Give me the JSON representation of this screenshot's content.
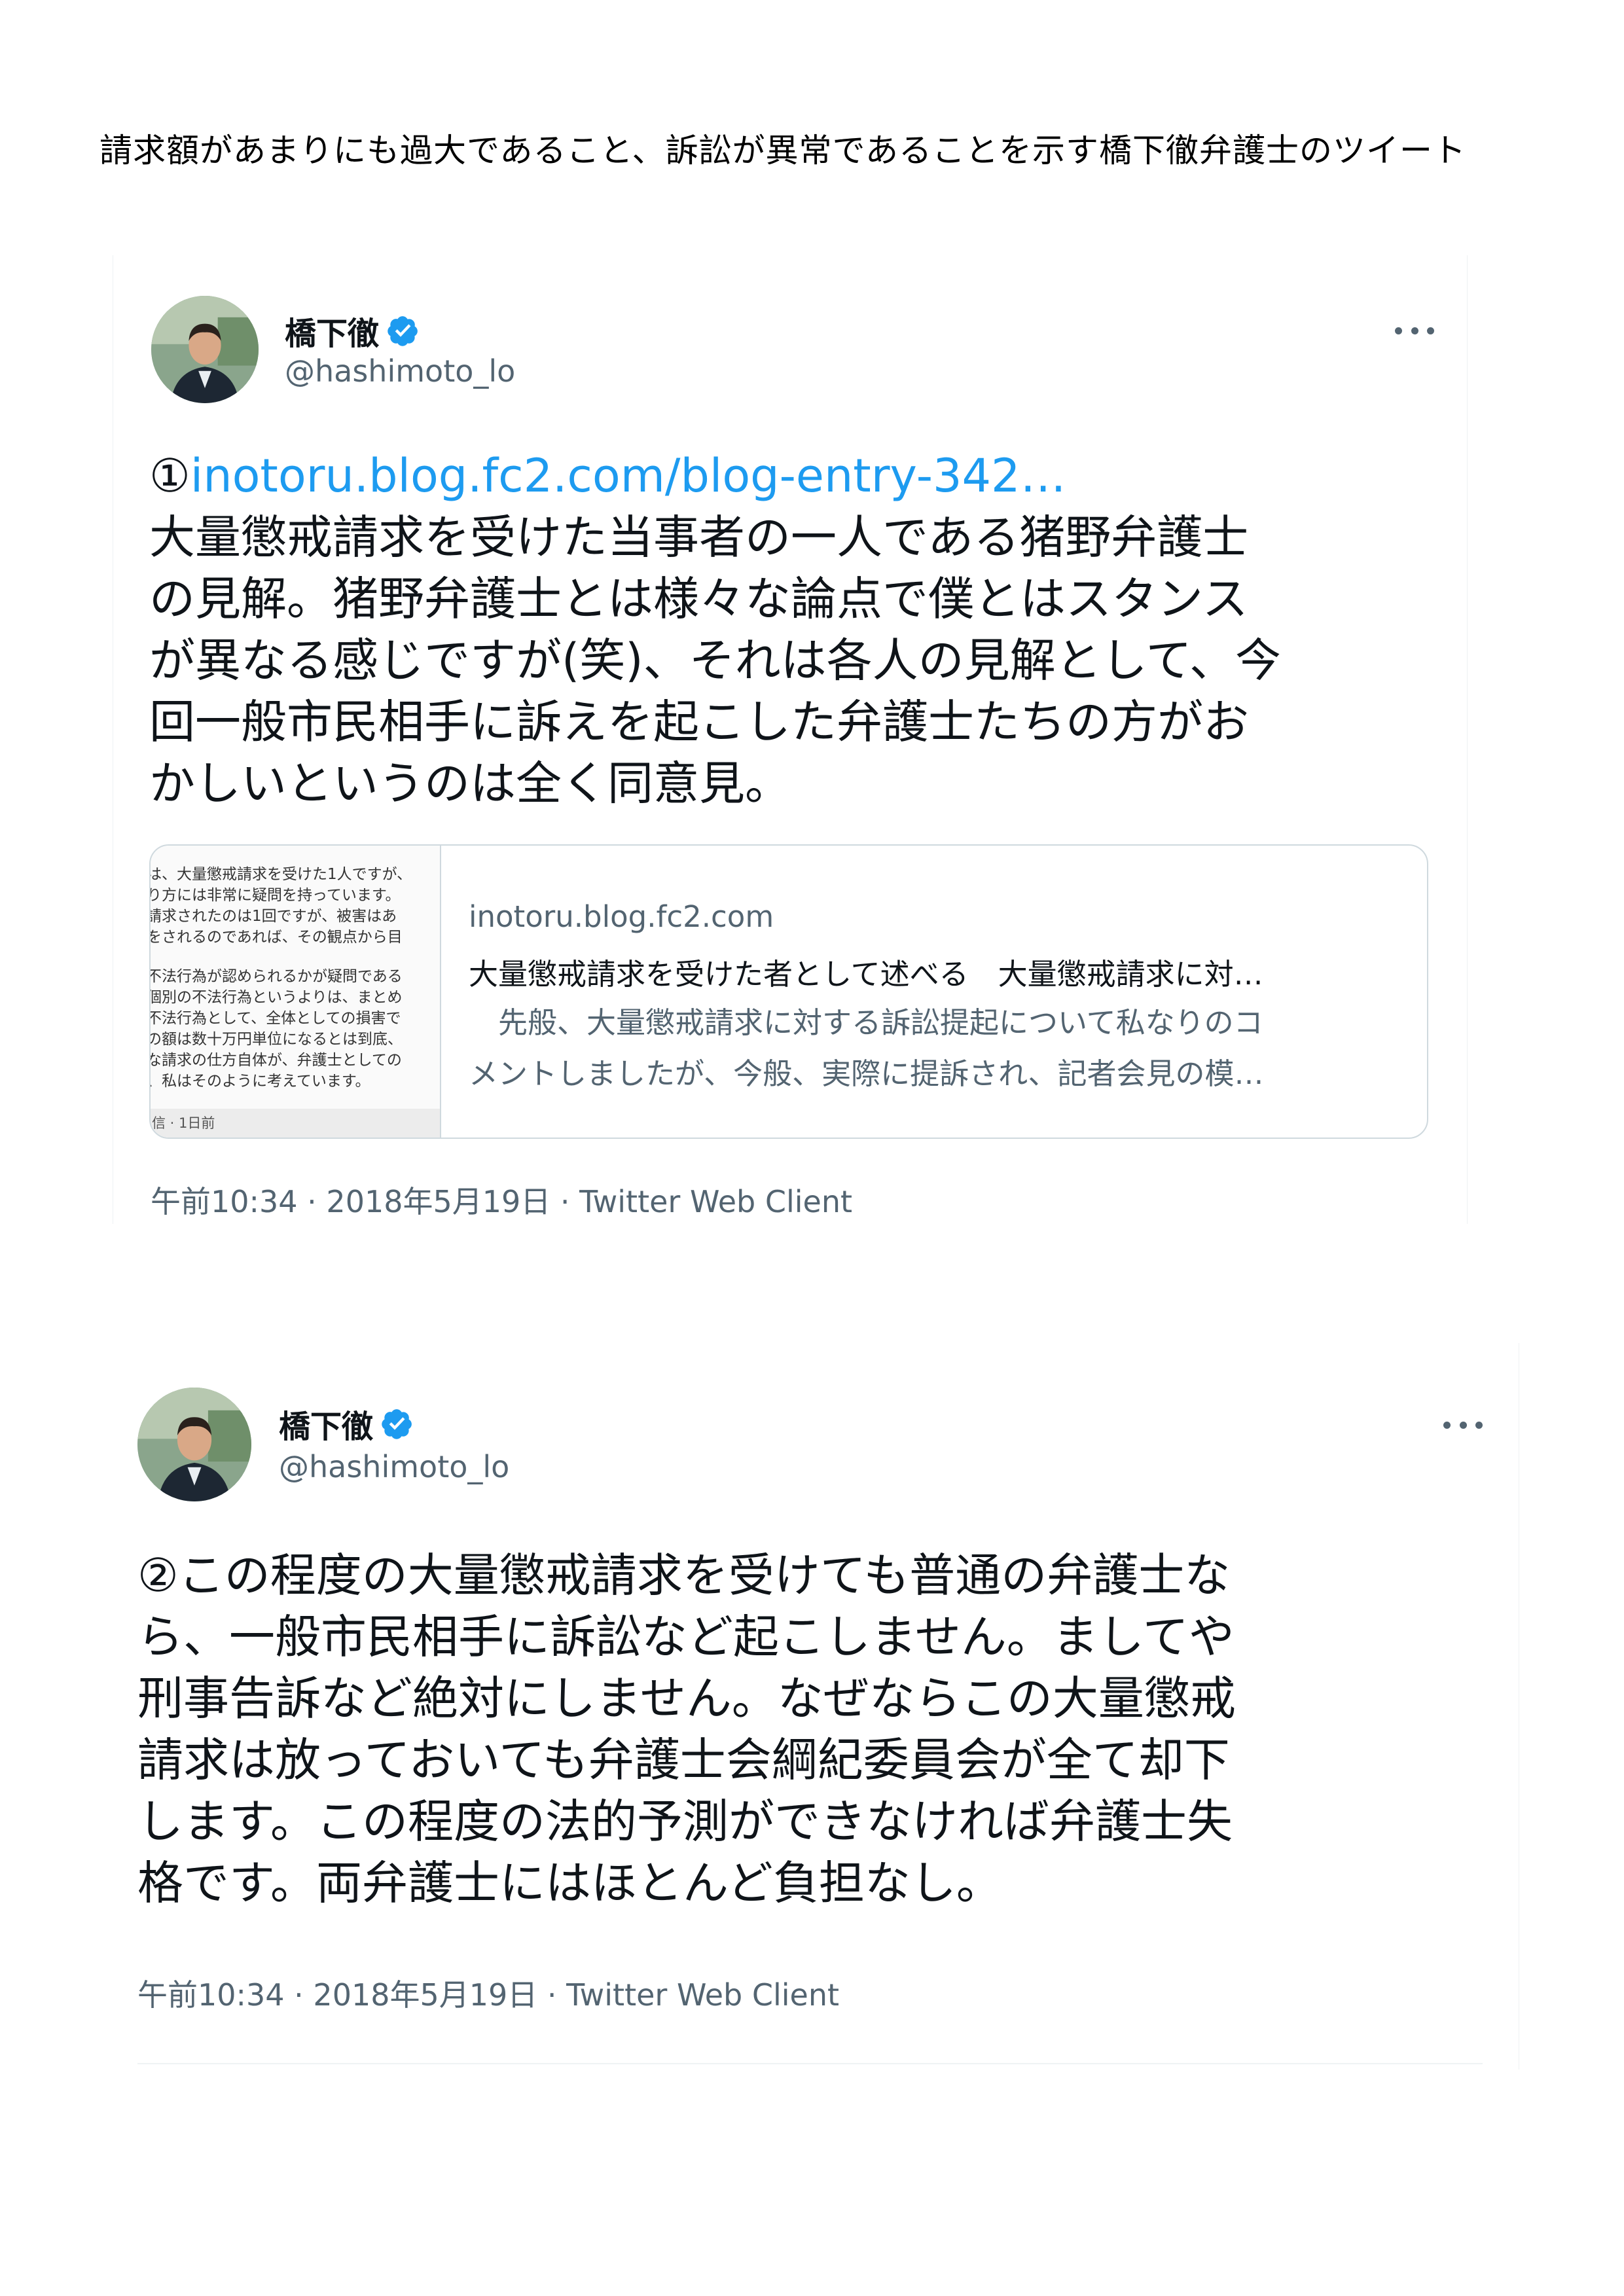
{
  "heading": "請求額があまりにも過大であること、訴訟が異常であることを示す橋下徹弁護士のツイート",
  "tweets": [
    {
      "name": "橋下徹",
      "handle": "@hashimoto_lo",
      "prefix": "①",
      "link": "inotoru.blog.fc2.com/blog-entry-342…",
      "lines": [
        "大量懲戒請求を受けた当事者の一人である猪野弁護士",
        "の見解。猪野弁護士とは様々な論点で僕とはスタンス",
        "が異なる感じですが(笑)、それは各人の見解として、今",
        "回一般市民相手に訴えを起こした弁護士たちの方がお",
        "かしいというのは全く同意見。"
      ],
      "card": {
        "thumb_lines": [
          "は、大量懲戒請求を受けた1人ですが、",
          "り方には非常に疑問を持っています。",
          "請求されたのは1回ですが、被害はあ",
          "をされるのであれば、その観点から目",
          "",
          "不法行為が認められるかが疑問である",
          "個別の不法行為というよりは、まとめ",
          "不法行為として、全体としての損害で",
          "の額は数十万円単位になるとは到底、",
          "な請求の仕方自体が、弁護士としての",
          "、私はそのように考えています。"
        ],
        "thumb_footer": "信 · 1日前",
        "domain": "inotoru.blog.fc2.com",
        "title": "大量懲戒請求を受けた者として述べる　大量懲戒請求に対…",
        "desc_lines": [
          "　先般、大量懲戒請求に対する訴訟提起について私なりのコ",
          "メントしましたが、今般、実際に提訴され、記者会見の模…"
        ]
      },
      "meta": "午前10:34 · 2018年5月19日 · Twitter Web Client"
    },
    {
      "name": "橋下徹",
      "handle": "@hashimoto_lo",
      "lines": [
        "②この程度の大量懲戒請求を受けても普通の弁護士な",
        "ら、一般市民相手に訴訟など起こしません。ましてや",
        "刑事告訴など絶対にしません。なぜならこの大量懲戒",
        "請求は放っておいても弁護士会綱紀委員会が全て却下",
        "します。この程度の法的予測ができなければ弁護士失",
        "格です。両弁護士にはほとんど負担なし。"
      ],
      "meta": "午前10:34 · 2018年5月19日 · Twitter Web Client"
    }
  ],
  "colors": {
    "link": "#1d9bf0",
    "verified": "#1d9bf0",
    "secondary_text": "#536471"
  },
  "icons": [
    "verified-badge-icon",
    "more-options-icon"
  ]
}
